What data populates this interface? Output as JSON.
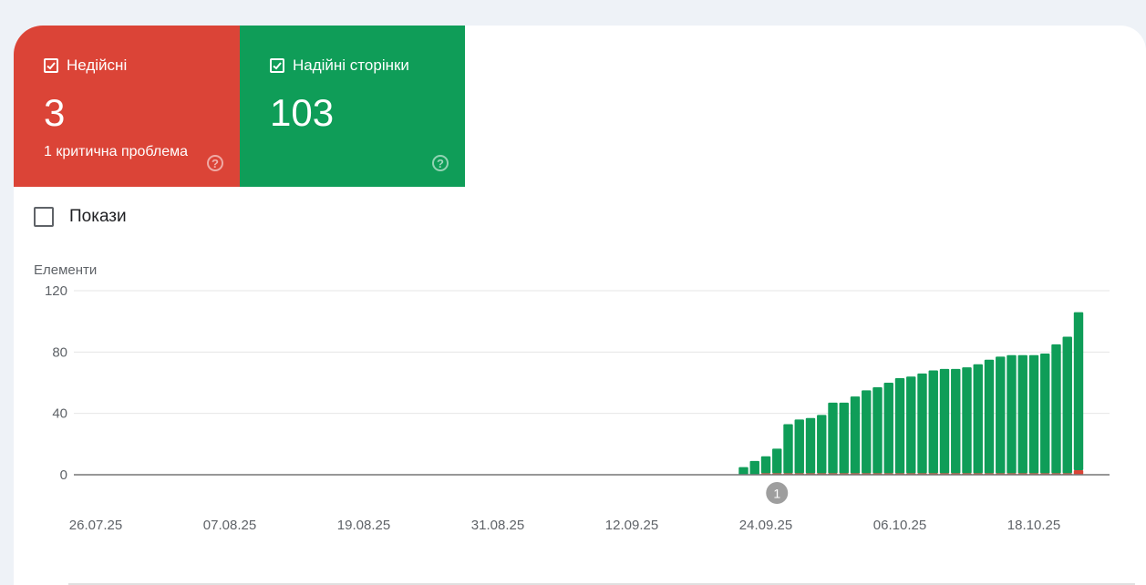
{
  "tiles": {
    "invalid": {
      "label": "Недійсні",
      "value": "3",
      "sub": "1 критична проблема",
      "help": "?",
      "color": "#db4437"
    },
    "valid": {
      "label": "Надійні сторінки",
      "value": "103",
      "help": "?",
      "color": "#0f9d58"
    }
  },
  "impressions_toggle": {
    "label": "Покази"
  },
  "chart_data": {
    "type": "bar",
    "stacked": true,
    "ylabel": "Елементи",
    "ylim": [
      0,
      120
    ],
    "yticks": [
      0,
      40,
      80,
      120
    ],
    "grid": true,
    "annotation": {
      "label": "1",
      "date": "25.09.25"
    },
    "xticks": [
      "26.07.25",
      "07.08.25",
      "19.08.25",
      "31.08.25",
      "12.09.25",
      "24.09.25",
      "06.10.25",
      "18.10.25"
    ],
    "categories": [
      "22.09.25",
      "23.09.25",
      "24.09.25",
      "25.09.25",
      "26.09.25",
      "27.09.25",
      "28.09.25",
      "29.09.25",
      "30.09.25",
      "01.10.25",
      "02.10.25",
      "03.10.25",
      "04.10.25",
      "05.10.25",
      "06.10.25",
      "07.10.25",
      "08.10.25",
      "09.10.25",
      "10.10.25",
      "11.10.25",
      "12.10.25",
      "13.10.25",
      "14.10.25",
      "15.10.25",
      "16.10.25",
      "17.10.25",
      "18.10.25",
      "19.10.25",
      "20.10.25",
      "21.10.25",
      "22.10.25"
    ],
    "series": [
      {
        "name": "Недійсні",
        "color": "#db4437",
        "values": [
          0,
          0,
          1,
          1,
          1,
          1,
          1,
          1,
          1,
          1,
          1,
          1,
          1,
          1,
          1,
          1,
          1,
          1,
          1,
          1,
          1,
          1,
          1,
          1,
          1,
          1,
          1,
          1,
          1,
          1,
          3
        ]
      },
      {
        "name": "Надійні сторінки",
        "color": "#0f9d58",
        "values": [
          5,
          9,
          11,
          16,
          32,
          35,
          36,
          38,
          46,
          46,
          50,
          54,
          56,
          59,
          62,
          63,
          65,
          67,
          68,
          68,
          69,
          71,
          74,
          76,
          77,
          77,
          77,
          78,
          84,
          89,
          103
        ]
      }
    ]
  }
}
